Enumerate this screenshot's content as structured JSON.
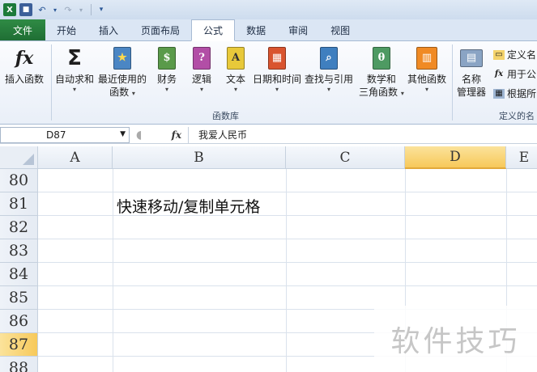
{
  "quick_access": {
    "excel_icon": "excel-icon",
    "save_icon": "save-icon",
    "undo_icon": "undo-icon",
    "redo_icon": "redo-icon",
    "customize_icon": "customize-icon"
  },
  "tabs": [
    {
      "label": "文件"
    },
    {
      "label": "开始"
    },
    {
      "label": "插入"
    },
    {
      "label": "页面布局"
    },
    {
      "label": "公式"
    },
    {
      "label": "数据"
    },
    {
      "label": "审阅"
    },
    {
      "label": "视图"
    }
  ],
  "ribbon": {
    "insert_function": "插入函数",
    "autosum": "自动求和",
    "recent_line1": "最近使用的",
    "recent_line2": "函数",
    "financial": "财务",
    "logical": "逻辑",
    "text": "文本",
    "datetime": "日期和时间",
    "lookup": "查找与引用",
    "math_line1": "数学和",
    "math_line2": "三角函数",
    "other": "其他函数",
    "group_library": "函数库",
    "name_mgr_line1": "名称",
    "name_mgr_line2": "管理器",
    "define_name": "定义名",
    "use_in_formula": "用于公",
    "create_from": "根据所",
    "group_defined": "定义的名"
  },
  "formula_bar": {
    "name_box": "D87",
    "fx": "fx",
    "content": "我爱人民币"
  },
  "columns": [
    "A",
    "B",
    "C",
    "D",
    "E"
  ],
  "rows": [
    "80",
    "81",
    "82",
    "83",
    "84",
    "85",
    "86",
    "87",
    "88"
  ],
  "cells": {
    "B81": "快速移动/复制单元格"
  },
  "watermark": "软件技巧",
  "colors": {
    "accent_green": "#1f6e34",
    "selection": "#f7c95a"
  }
}
